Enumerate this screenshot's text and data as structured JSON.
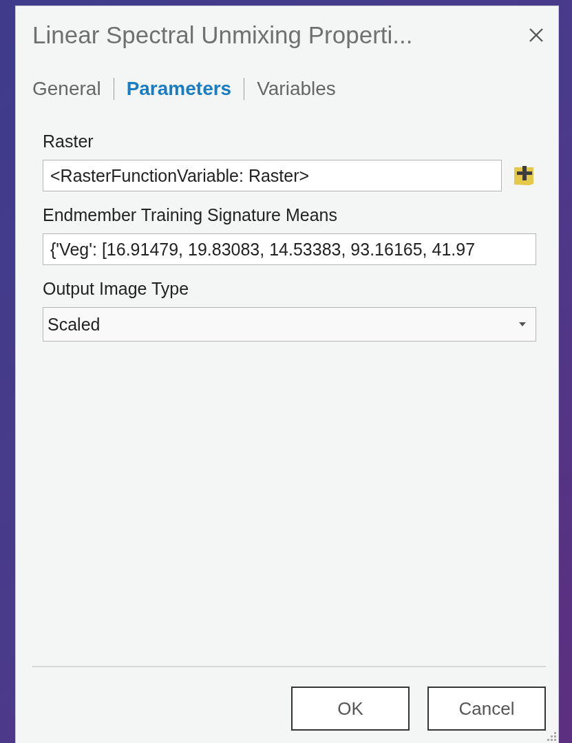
{
  "window": {
    "title": "Linear Spectral Unmixing Properti..."
  },
  "tabs": [
    {
      "label": "General",
      "selected": false
    },
    {
      "label": "Parameters",
      "selected": true
    },
    {
      "label": "Variables",
      "selected": false
    }
  ],
  "parameters": [
    {
      "label": "Raster",
      "kind": "variable",
      "value": "<RasterFunctionVariable: Raster>"
    },
    {
      "label": "Endmember Training Signature Means",
      "kind": "text",
      "value": "{'Veg': [16.91479, 19.83083, 14.53383, 93.16165, 41.97"
    },
    {
      "label": "Output Image Type",
      "kind": "dropdown",
      "value": "Scaled"
    }
  ],
  "buttons": [
    "OK",
    "Cancel"
  ]
}
